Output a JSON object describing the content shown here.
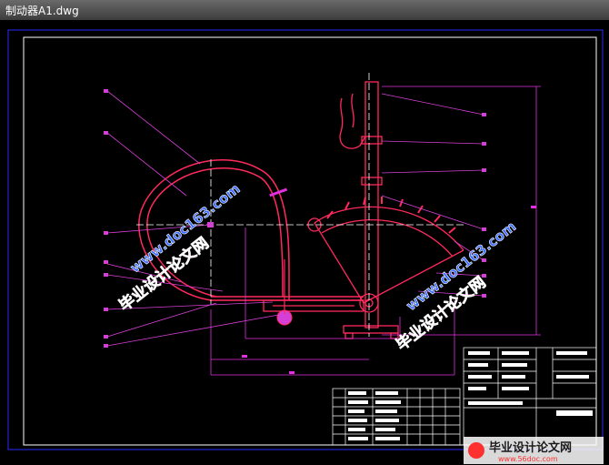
{
  "window": {
    "title": "制动器A1.dwg"
  },
  "drawing": {
    "watermarks": [
      {
        "cn": "毕业设计论文网",
        "url": "www.doc163.com"
      },
      {
        "cn": "毕业设计论文网",
        "url": "www.doc163.com"
      }
    ],
    "corner_logo": {
      "cn": "毕业设计论文网",
      "url": "www.56doc.com"
    }
  },
  "colors": {
    "frame": "#2a2aff",
    "border": "#ffffff",
    "part": "#ff2a5c",
    "leader": "#d63fd6",
    "dim": "#e030e0",
    "wm_red": "#ff3030",
    "wm_blue": "#3a6cff"
  }
}
